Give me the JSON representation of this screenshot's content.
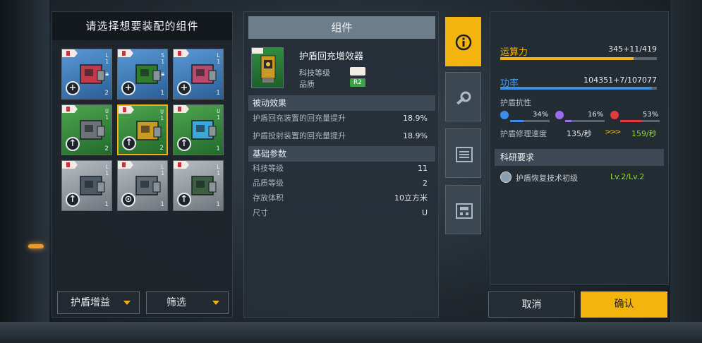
{
  "left_panel": {
    "title": "请选择想要装配的组件",
    "slots": [
      {
        "level_lines": [
          "L",
          "1"
        ],
        "count": "2",
        "locked": true,
        "action": "+"
      },
      {
        "level_lines": [
          "S",
          "1"
        ],
        "count": "1",
        "locked": true,
        "action": "+"
      },
      {
        "level_lines": [
          "L",
          "1"
        ],
        "count": "1",
        "locked": false,
        "action": "+"
      },
      {
        "level_lines": [
          "U",
          "1"
        ],
        "count": "2",
        "locked": false,
        "action": "↑"
      },
      {
        "level_lines": [
          "U",
          "1"
        ],
        "count": "2",
        "locked": false,
        "action": "↑",
        "selected": true
      },
      {
        "level_lines": [
          "U",
          "1"
        ],
        "count": "1",
        "locked": false,
        "action": "↑"
      },
      {
        "level_lines": [
          "L",
          "1"
        ],
        "count": "1",
        "locked": false,
        "action": "↑"
      },
      {
        "level_lines": [
          "L",
          "1"
        ],
        "count": "1",
        "locked": false,
        "action": "⊙"
      },
      {
        "level_lines": [
          "L",
          "1"
        ],
        "count": "1",
        "locked": false,
        "action": "↑"
      }
    ],
    "filter1_label": "护盾增益",
    "filter2_label": "筛选"
  },
  "middle_panel": {
    "title": "组件",
    "item_name": "护盾回充增效器",
    "tech_level_label": "科技等级",
    "quality_label": "品质",
    "quality_value": "R2",
    "passive_section": "被动效果",
    "passives": [
      {
        "label": "护盾回充装置的回充量提升",
        "value": "18.9%"
      },
      {
        "label": "护盾投射装置的回充量提升",
        "value": "18.9%"
      }
    ],
    "base_section": "基础参数",
    "base_params": [
      {
        "label": "科技等级",
        "value": "11"
      },
      {
        "label": "品质等级",
        "value": "2"
      },
      {
        "label": "存放体积",
        "value": "10立方米"
      },
      {
        "label": "尺寸",
        "value": "U"
      }
    ]
  },
  "tabs": [
    {
      "icon": "info-icon",
      "active": true
    },
    {
      "icon": "gear-wrench-icon",
      "active": false
    },
    {
      "icon": "list-icon",
      "active": false
    },
    {
      "icon": "blueprint-icon",
      "active": false
    }
  ],
  "right_panel": {
    "compute_label": "运算力",
    "compute_value": "345+11/419",
    "compute_fraction": 0.85,
    "power_label": "功率",
    "power_value": "104351+7/107077",
    "power_fraction": 0.97,
    "shield_resist_label": "护盾抗性",
    "resists": [
      {
        "type": "electric",
        "color": "#3b8ee6",
        "value": "34%",
        "fraction": 0.34
      },
      {
        "type": "plasma",
        "color": "#9a6cf0",
        "value": "16%",
        "fraction": 0.16
      },
      {
        "type": "thermal",
        "color": "#e23b3b",
        "value": "53%",
        "fraction": 0.53
      }
    ],
    "repair_label": "护盾修理速度",
    "repair_value": "135/秒",
    "repair_new": "159/秒",
    "research_section": "科研要求",
    "research_item": "护盾恢复技术初级",
    "research_level": "Lv.2/Lv.2",
    "colors": {
      "accent": "#f4b40e",
      "compute_bar": "#f4b40e",
      "power_bar": "#3b8ee6",
      "new_value": "#8fd63a"
    }
  },
  "buttons": {
    "cancel_label": "取消",
    "confirm_label": "确认"
  }
}
